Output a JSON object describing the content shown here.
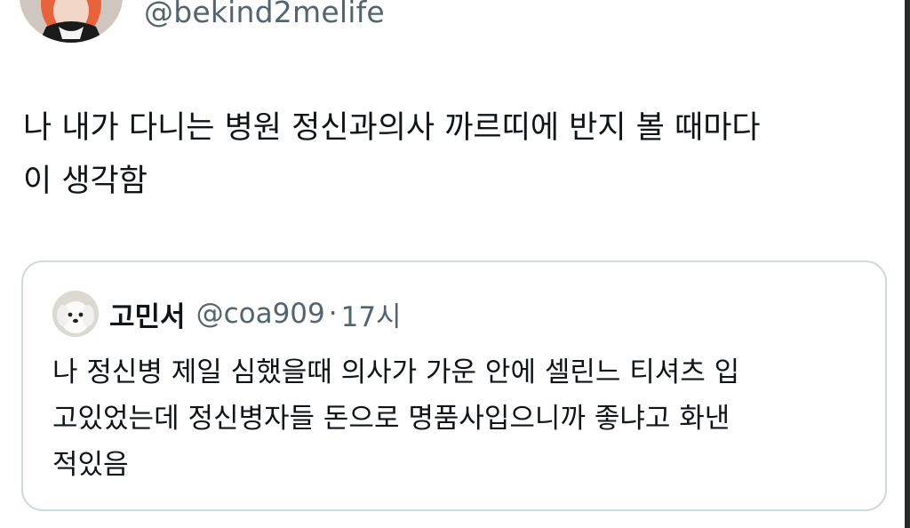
{
  "tweet": {
    "handle": "@bekind2melife",
    "avatar_icon": "profile-photo-avatar",
    "text_line1": "나 내가 다니는 병원 정신과의사 까르띠에 반지 볼 때마다",
    "text_line2": "이 생각함"
  },
  "quote": {
    "avatar_icon": "white-puppy-avatar",
    "name": "고민서",
    "handle": "@coa909",
    "separator": "·",
    "time": "17시",
    "text_line1": "나 정신병 제일 심했을때 의사가 가운 안에 셀린느 티셔츠 입",
    "text_line2": "고있었는데 정신병자들 돈으로 명품사입으니까 좋냐고 화낸",
    "text_line3": "적있음"
  },
  "colors": {
    "text_primary": "#0f1419",
    "text_secondary": "#536471",
    "card_border": "#cfd9de",
    "background": "#ffffff"
  }
}
